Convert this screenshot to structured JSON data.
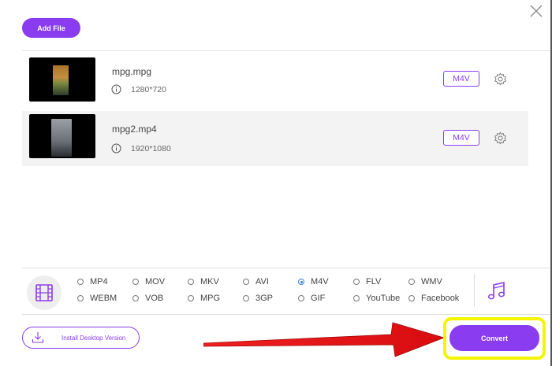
{
  "toolbar": {
    "add_file_label": "Add File"
  },
  "files": [
    {
      "name": "mpg.mpg",
      "resolution": "1280*720",
      "format": "M4V"
    },
    {
      "name": "mpg2.mp4",
      "resolution": "1920*1080",
      "format": "M4V"
    }
  ],
  "formats": [
    {
      "label": "MP4",
      "selected": false
    },
    {
      "label": "MOV",
      "selected": false
    },
    {
      "label": "MKV",
      "selected": false
    },
    {
      "label": "AVI",
      "selected": false
    },
    {
      "label": "M4V",
      "selected": true
    },
    {
      "label": "FLV",
      "selected": false
    },
    {
      "label": "WMV",
      "selected": false
    },
    {
      "label": "WEBM",
      "selected": false
    },
    {
      "label": "VOB",
      "selected": false
    },
    {
      "label": "MPG",
      "selected": false
    },
    {
      "label": "3GP",
      "selected": false
    },
    {
      "label": "GIF",
      "selected": false
    },
    {
      "label": "YouTube",
      "selected": false
    },
    {
      "label": "Facebook",
      "selected": false
    }
  ],
  "footer": {
    "install_label": "Install Desktop Version",
    "convert_label": "Convert"
  },
  "colors": {
    "accent": "#8a3cf0",
    "highlight": "#f5f500",
    "arrow": "#e8141a"
  },
  "icons": [
    "close-icon",
    "info-icon",
    "gear-icon",
    "video-format-icon",
    "music-note-icon",
    "download-icon"
  ]
}
